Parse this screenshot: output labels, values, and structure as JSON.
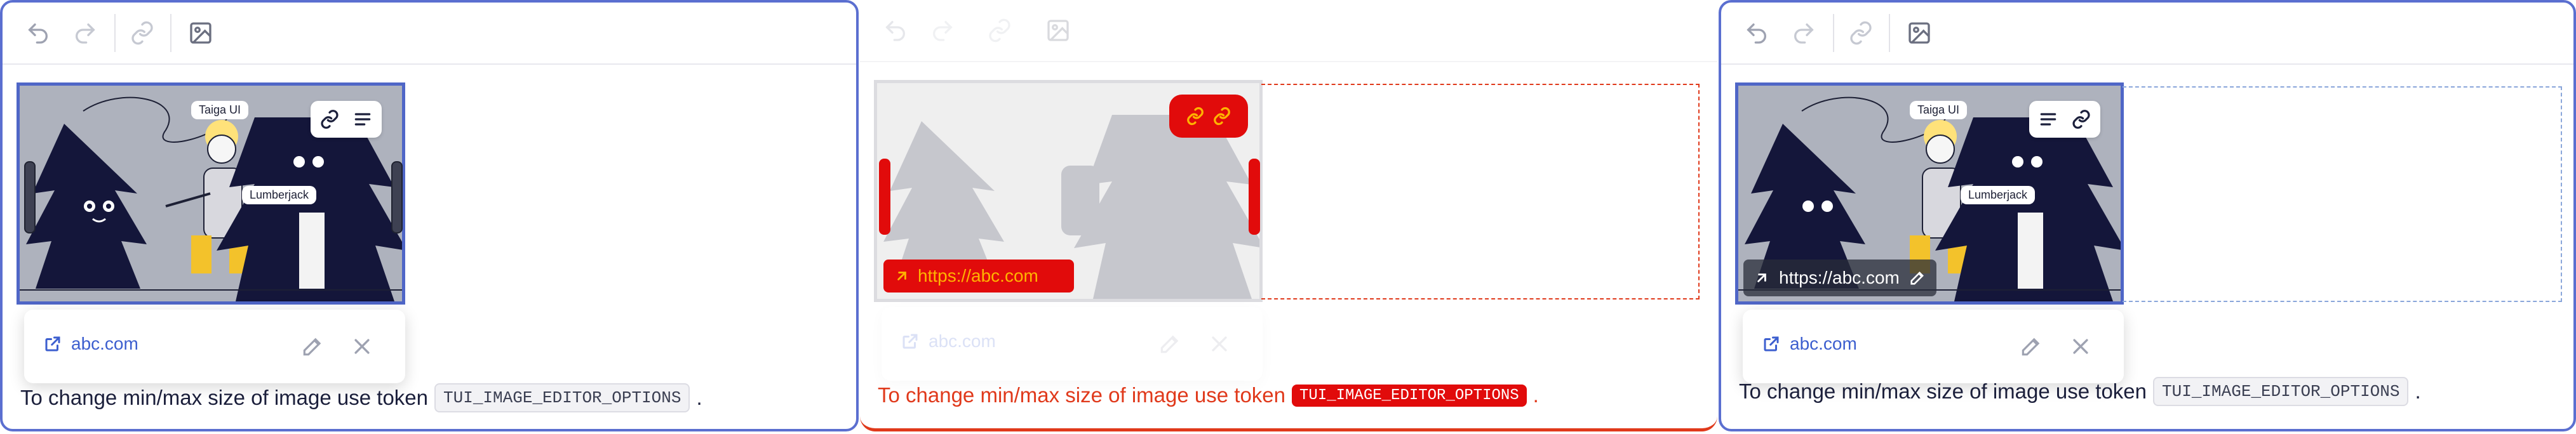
{
  "toolbar": {
    "undo_icon": "undo-icon",
    "redo_icon": "redo-icon",
    "link_icon": "link-icon",
    "image_icon": "image-icon"
  },
  "illustration": {
    "label_1": "Taiga UI",
    "label_2": "Lumberjack"
  },
  "image_toolbar": {
    "align_icon": "align-icon",
    "link_icon": "link-icon"
  },
  "image_link": {
    "url": "https://abc.com",
    "edit_icon": "pencil-icon"
  },
  "link_popup": {
    "url": "abc.com",
    "external_icon": "external-link-icon",
    "edit_icon": "pencil-icon",
    "close_icon": "close-icon"
  },
  "caption": {
    "text": "To change min/max size of image use token",
    "token": "TUI_IMAGE_EDITOR_OPTIONS",
    "suffix": "."
  },
  "colors": {
    "accent": "#4f66c7",
    "link": "#3d5fcf",
    "error": "#e10b0b"
  }
}
